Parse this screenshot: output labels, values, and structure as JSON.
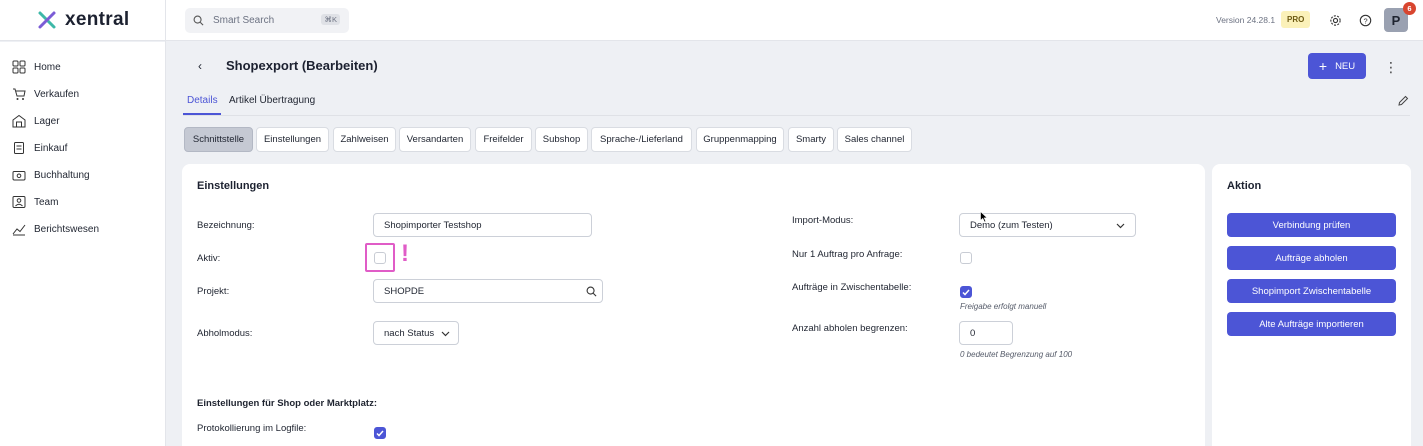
{
  "app": {
    "name": "xentral",
    "version": "Version 24.28.1",
    "plan_badge": "PRO",
    "avatar_initial": "P",
    "notification_count": "6"
  },
  "search": {
    "placeholder": "Smart Search",
    "shortcut": "⌘K"
  },
  "sidebar": {
    "items": [
      {
        "label": "Home",
        "icon": "dashboard-icon"
      },
      {
        "label": "Verkaufen",
        "icon": "cart-icon"
      },
      {
        "label": "Lager",
        "icon": "warehouse-icon"
      },
      {
        "label": "Einkauf",
        "icon": "purchase-icon"
      },
      {
        "label": "Buchhaltung",
        "icon": "accounting-icon"
      },
      {
        "label": "Team",
        "icon": "team-icon"
      },
      {
        "label": "Berichtswesen",
        "icon": "reports-icon"
      }
    ]
  },
  "header": {
    "title": "Shopexport (Bearbeiten)",
    "new_button": "NEU"
  },
  "subtabs": [
    {
      "label": "Details",
      "active": true
    },
    {
      "label": "Artikel Übertragung",
      "active": false
    }
  ],
  "section_tabs": [
    {
      "label": "Schnittstelle",
      "active": true
    },
    {
      "label": "Einstellungen",
      "active": false
    },
    {
      "label": "Zahlweisen",
      "active": false
    },
    {
      "label": "Versandarten",
      "active": false
    },
    {
      "label": "Freifelder",
      "active": false
    },
    {
      "label": "Subshop",
      "active": false
    },
    {
      "label": "Sprache-/Lieferland",
      "active": false
    },
    {
      "label": "Gruppenmapping",
      "active": false
    },
    {
      "label": "Smarty",
      "active": false
    },
    {
      "label": "Sales channel",
      "active": false
    }
  ],
  "settings": {
    "title": "Einstellungen",
    "bezeichnung": {
      "label": "Bezeichnung:",
      "value": "Shopimporter Testshop"
    },
    "aktiv": {
      "label": "Aktiv:",
      "checked": false,
      "marker": "!"
    },
    "projekt": {
      "label": "Projekt:",
      "value": "SHOPDE"
    },
    "abholmodus": {
      "label": "Abholmodus:",
      "value": "nach Status"
    },
    "import_modus": {
      "label": "Import-Modus:",
      "value": "Demo (zum Testen)"
    },
    "nur_ein_auftrag": {
      "label": "Nur 1 Auftrag pro Anfrage:",
      "checked": false
    },
    "zwischentabelle": {
      "label": "Aufträge in Zwischentabelle:",
      "checked": true,
      "hint": "Freigabe erfolgt manuell"
    },
    "anzahl": {
      "label": "Anzahl abholen begrenzen:",
      "value": "0",
      "hint": "0 bedeutet Begrenzung auf 100"
    },
    "shop_section_title": "Einstellungen für Shop oder Marktplatz:",
    "protokollierung": {
      "label": "Protokollierung im Logfile:",
      "checked": true
    }
  },
  "aktion": {
    "title": "Aktion",
    "buttons": [
      "Verbindung prüfen",
      "Aufträge abholen",
      "Shopimport Zwischentabelle",
      "Alte Aufträge importieren"
    ]
  },
  "colors": {
    "accent": "#4c55d6",
    "highlight": "#e05cc7",
    "badge": "#fbf1b9"
  }
}
